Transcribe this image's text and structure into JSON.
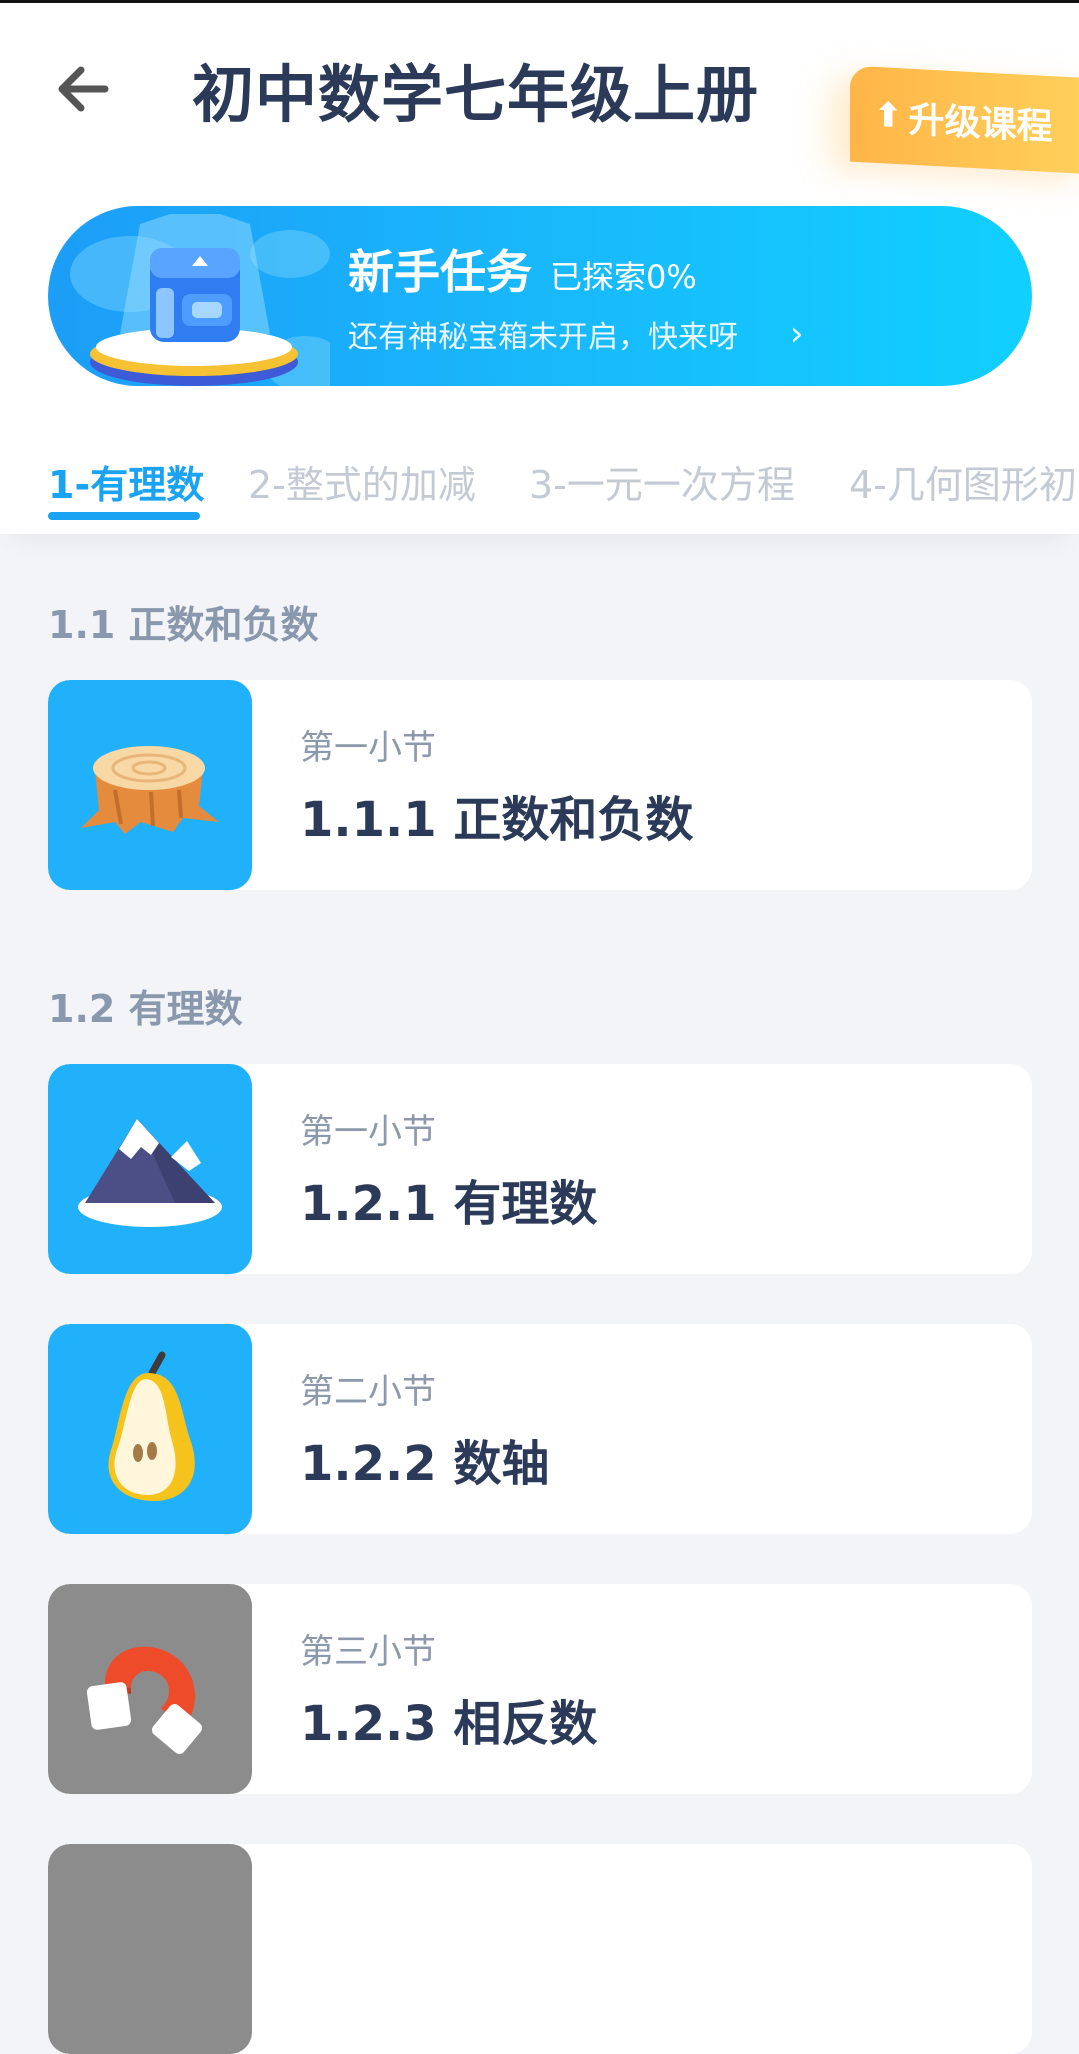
{
  "header": {
    "title": "初中数学七年级上册",
    "back_icon": "arrow-left-icon",
    "upgrade_label": "升级课程",
    "upgrade_icon": "arrow-up-icon"
  },
  "banner": {
    "title": "新手任务",
    "progress": "已探索0%",
    "subtitle": "还有神秘宝箱未开启，快来呀",
    "chevron": "›",
    "icon": "treasure-chest-icon"
  },
  "tabs": [
    {
      "label": "1-有理数",
      "active": true
    },
    {
      "label": "2-整式的加减",
      "active": false
    },
    {
      "label": "3-一元一次方程",
      "active": false
    },
    {
      "label": "4-几何图形初",
      "active": false
    }
  ],
  "sections": [
    {
      "title": "1.1 正数和负数",
      "lessons": [
        {
          "label": "第一小节",
          "title": "1.1.1 正数和负数",
          "icon": "tree-stump-icon",
          "locked": false
        }
      ]
    },
    {
      "title": "1.2 有理数",
      "lessons": [
        {
          "label": "第一小节",
          "title": "1.2.1 有理数",
          "icon": "mountain-icon",
          "locked": false
        },
        {
          "label": "第二小节",
          "title": "1.2.2 数轴",
          "icon": "pear-icon",
          "locked": false
        },
        {
          "label": "第三小节",
          "title": "1.2.3 相反数",
          "icon": "magnet-icon",
          "locked": true
        }
      ]
    }
  ],
  "colors": {
    "accent": "#1aa3f2",
    "card_active_bg": "#21b1fb",
    "card_locked_bg": "#8c8c8c",
    "title_text": "#2b3a58",
    "muted_text": "#8a98ad"
  }
}
